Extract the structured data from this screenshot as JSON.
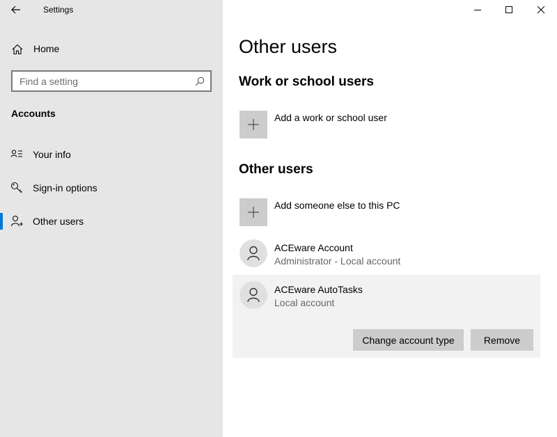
{
  "window": {
    "title": "Settings"
  },
  "sidebar": {
    "home_label": "Home",
    "search_placeholder": "Find a setting",
    "section_label": "Accounts",
    "items": [
      {
        "label": "Your info",
        "icon": "contact-card-icon"
      },
      {
        "label": "Sign-in options",
        "icon": "key-icon"
      },
      {
        "label": "Other users",
        "icon": "add-person-icon",
        "selected": true
      }
    ]
  },
  "main": {
    "title": "Other users",
    "work_section": {
      "heading": "Work or school users",
      "add_label": "Add a work or school user"
    },
    "other_section": {
      "heading": "Other users",
      "add_label": "Add someone else to this PC",
      "users": [
        {
          "name": "ACEware Account",
          "type": "Administrator - Local account"
        },
        {
          "name": "ACEware AutoTasks",
          "type": "Local account",
          "expanded": true
        }
      ]
    },
    "buttons": {
      "change_type": "Change account type",
      "remove": "Remove"
    }
  },
  "colors": {
    "accent": "#0078d7",
    "sidebar_bg": "#e6e6e6",
    "tile_bg": "#cccccc"
  }
}
